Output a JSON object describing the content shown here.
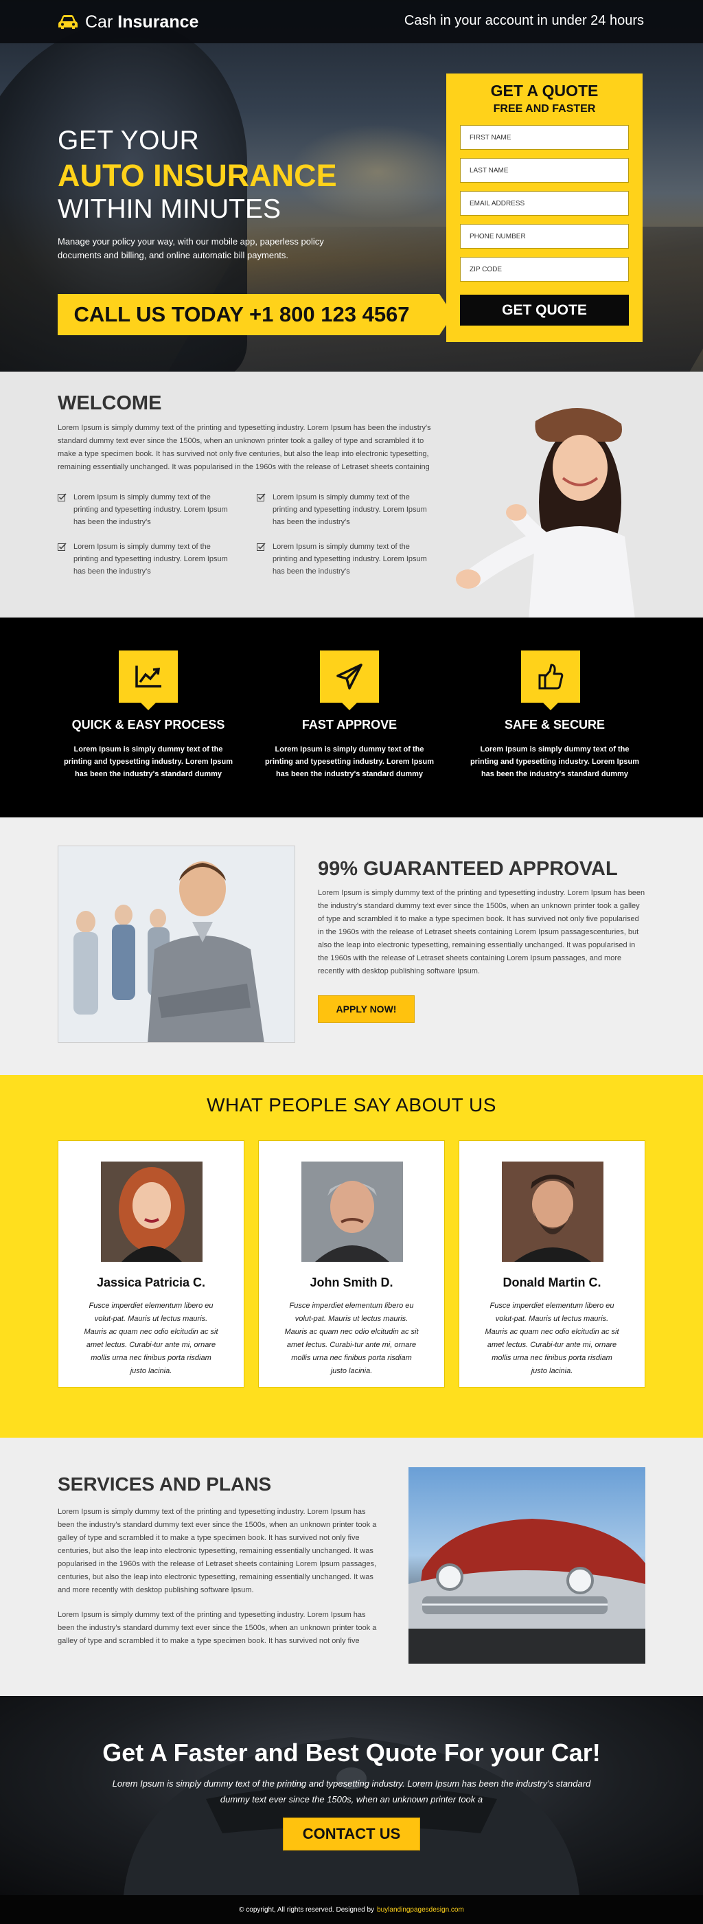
{
  "header": {
    "brand_part1": "Car",
    "brand_part2": "Insurance",
    "tagline": "Cash in your account in under 24 hours"
  },
  "hero": {
    "line1": "GET YOUR",
    "line2": "AUTO INSURANCE",
    "line3": "WITHIN MINUTES",
    "description": "Manage your policy your way, with our mobile app, paperless policy documents and billing, and online automatic bill payments.",
    "call_label": "CALL US TODAY +1 800 123 4567"
  },
  "quote_form": {
    "title": "GET A QUOTE",
    "subtitle": "FREE AND FASTER",
    "fields": [
      {
        "placeholder": "FIRST NAME"
      },
      {
        "placeholder": "LAST NAME"
      },
      {
        "placeholder": "EMAIL ADDRESS"
      },
      {
        "placeholder": "PHONE NUMBER"
      },
      {
        "placeholder": "ZIP CODE"
      }
    ],
    "submit_label": "GET QUOTE"
  },
  "welcome": {
    "title": "WELCOME",
    "text": "Lorem Ipsum is simply dummy text of the printing and typesetting industry. Lorem Ipsum has been the industry's standard dummy text ever since the 1500s, when an unknown printer took a galley of type and scrambled it to make a type specimen book. It has survived not only five centuries, but also the leap into electronic typesetting, remaining essentially unchanged. It was popularised in the 1960s with the release of Letraset sheets containing",
    "items": [
      "Lorem Ipsum is simply dummy text of the printing and typesetting industry. Lorem Ipsum has been the industry's",
      "Lorem Ipsum is simply dummy text of the printing and typesetting industry. Lorem Ipsum has been the industry's",
      "Lorem Ipsum is simply dummy text of the printing and typesetting industry. Lorem Ipsum has been the industry's",
      "Lorem Ipsum is simply dummy text of the printing and typesetting industry. Lorem Ipsum has been the industry's"
    ]
  },
  "features": [
    {
      "icon": "chart-icon",
      "title": "QUICK & EASY PROCESS",
      "text": "Lorem Ipsum is simply dummy text of the printing and typesetting industry. Lorem Ipsum has been the industry's standard dummy"
    },
    {
      "icon": "paper-plane-icon",
      "title": "FAST APPROVE",
      "text": "Lorem Ipsum is simply dummy text of the printing and typesetting industry. Lorem Ipsum has been the industry's standard dummy"
    },
    {
      "icon": "thumbs-up-icon",
      "title": "SAFE & SECURE",
      "text": "Lorem Ipsum is simply dummy text of the printing and typesetting industry. Lorem Ipsum has been the industry's standard dummy"
    }
  ],
  "approval": {
    "title": "99% GUARANTEED APPROVAL",
    "text": "Lorem Ipsum is simply dummy text of the printing and typesetting industry. Lorem Ipsum has been the industry's standard dummy text ever since the 1500s, when an unknown printer took a galley of type and scrambled it to make a type specimen book. It has survived not only five  popularised in the 1960s with the release of Letraset sheets containing Lorem Ipsum passagescenturies, but also the leap into electronic typesetting, remaining essentially unchanged. It was popularised in the 1960s with the release of Letraset sheets containing Lorem Ipsum passages, and more recently with desktop publishing software Ipsum.",
    "button_label": "APPLY NOW!"
  },
  "testimonials": {
    "title": "WHAT PEOPLE SAY ABOUT US",
    "items": [
      {
        "name": "Jassica Patricia C.",
        "text": "Fusce imperdiet elementum libero eu volut-pat. Mauris ut lectus mauris. Mauris ac quam nec odio elcitudin ac sit amet lectus. Curabi-tur ante mi, ornare mollis urna nec finibus porta risdiam justo lacinia."
      },
      {
        "name": "John Smith D.",
        "text": "Fusce imperdiet elementum libero eu volut-pat. Mauris ut lectus mauris. Mauris ac quam nec odio elcitudin ac sit amet lectus. Curabi-tur ante mi, ornare mollis urna nec finibus porta risdiam justo lacinia."
      },
      {
        "name": "Donald Martin C.",
        "text": "Fusce imperdiet elementum libero eu volut-pat. Mauris ut lectus mauris. Mauris ac quam nec odio elcitudin ac sit amet lectus. Curabi-tur ante mi, ornare mollis urna nec finibus porta risdiam justo lacinia."
      }
    ]
  },
  "services": {
    "title": "SERVICES AND PLANS",
    "paragraph1": "Lorem Ipsum is simply dummy text of the printing and typesetting industry. Lorem Ipsum has been the industry's standard dummy text ever since the 1500s, when an unknown printer took a galley of type and scrambled it to make a type specimen book. It has survived not only five centuries, but also the leap into electronic typesetting, remaining essentially unchanged. It was popularised in the 1960s with the release of Letraset sheets containing Lorem Ipsum passages, centuries, but also the leap into electronic typesetting, remaining essentially unchanged. It was and more recently with desktop publishing software Ipsum.",
    "paragraph2": "Lorem Ipsum is simply dummy text of the printing and typesetting industry. Lorem Ipsum has been the industry's standard dummy text ever since the 1500s, when an unknown printer took a galley of type and scrambled it to make a type specimen book. It has survived not only five"
  },
  "cta": {
    "title": "Get A Faster and Best Quote For your Car!",
    "text": "Lorem Ipsum is simply dummy text of the printing and typesetting industry. Lorem Ipsum has been the industry's standard dummy text ever since the 1500s, when an unknown printer took a",
    "button_label": "CONTACT US"
  },
  "footer": {
    "text": "© copyright, All rights reserved. Designed by",
    "link": "buylandingpagesdesign.com"
  },
  "colors": {
    "accent_yellow": "#ffd21a",
    "dark": "#000000"
  }
}
